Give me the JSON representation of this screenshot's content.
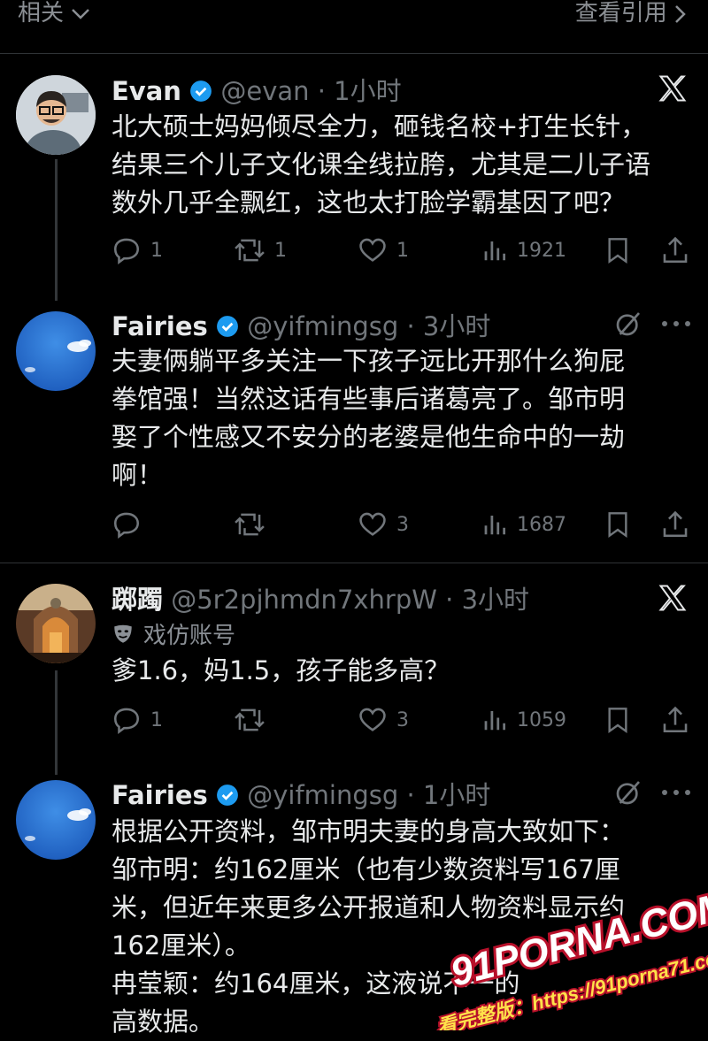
{
  "topbar": {
    "related_label": "相关",
    "quotes_label": "查看引用"
  },
  "posts": [
    {
      "name": "Evan",
      "handle_time": "@evan · 1小时",
      "text_lines": [
        "北大硕士妈妈倾尽全力，砸钱名校+打生长针，",
        "结果三个儿子文化课全线拉胯，尤其是二儿子语",
        "数外几乎全飘红，这也太打脸学霸基因了吧？"
      ],
      "replies": "1",
      "reposts": "1",
      "likes": "1",
      "views": "1921"
    },
    {
      "name": "Fairies",
      "handle_time": "@yifmingsg · 3小时",
      "text_lines": [
        "夫妻俩躺平多关注一下孩子远比开那什么狗屁",
        "拳馆强！当然这话有些事后诸葛亮了。邹市明",
        "娶了个性感又不安分的老婆是他生命中的一劫",
        "啊！"
      ],
      "replies": "",
      "reposts": "",
      "likes": "3",
      "views": "1687"
    },
    {
      "name": "踯躅",
      "handle_time": "@5r2pjhmdn7xhrpW · 3小时",
      "parody_label": "戏仿账号",
      "text_lines": [
        "爹1.6，妈1.5，孩子能多高？"
      ],
      "replies": "1",
      "reposts": "",
      "likes": "3",
      "views": "1059"
    },
    {
      "name": "Fairies",
      "handle_time": "@yifmingsg · 1小时",
      "text_lines": [
        "根据公开资料，邹市明夫妻的身高大致如下：",
        "邹市明：约162厘米（也有少数资料写167厘",
        "米，但近年来更多公开报道和人物资料显示约",
        "162厘米）。",
        "冉莹颖：约164厘米，这液说不一的",
        "高数据。"
      ]
    }
  ],
  "watermark": {
    "line1": "91PORNA.COM",
    "line2": "看完整版：https://91porna71.com"
  }
}
